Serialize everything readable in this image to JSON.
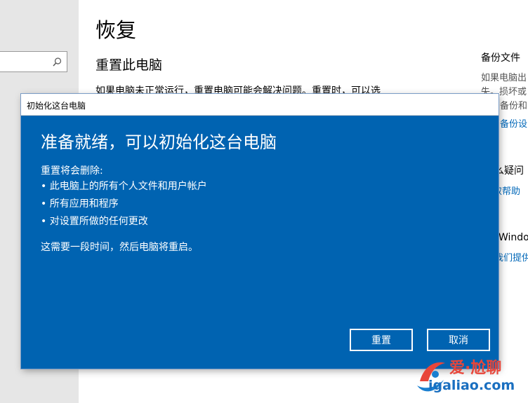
{
  "settings": {
    "page_title": "恢复",
    "section_title": "重置此电脑",
    "section_desc": "如果电脑未正常运行，重置电脑可能会解决问题。重置时，可以选",
    "right_col": {
      "heading": "备份文件",
      "line1": "如果电脑出",
      "line2": "失。损坏或",
      "line3": "备份和",
      "link1": "备份设",
      "q_heading": "么疑问",
      "help_link": "取帮助",
      "windows_text": "Window",
      "feedback_link": "我们提供"
    }
  },
  "dialog": {
    "title": "初始化这台电脑",
    "heading": "准备就绪，可以初始化这台电脑",
    "intro": "重置将会删除:",
    "items": [
      "此电脑上的所有个人文件和用户帐户",
      "所有应用和程序",
      "对设置所做的任何更改"
    ],
    "note": "这需要一段时间，然后电脑将重启。",
    "reset_label": "重置",
    "cancel_label": "取消"
  },
  "watermark": {
    "text_cn": "爱·尬聊",
    "text_url": "igaliao.com"
  },
  "colors": {
    "dialog_blue": "#0063b1",
    "link_blue": "#0067b8",
    "watermark_red": "#e8463a"
  }
}
